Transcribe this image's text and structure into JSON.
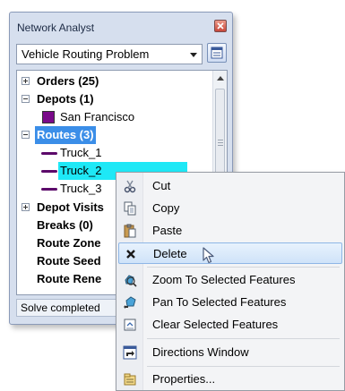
{
  "window": {
    "title": "Network Analyst",
    "combo_value": "Vehicle Routing Problem",
    "status": "Solve completed"
  },
  "tree": {
    "orders": "Orders (25)",
    "depots": "Depots (1)",
    "depot_item": "San Francisco",
    "routes": "Routes (3)",
    "route_items": [
      "Truck_1",
      "Truck_2",
      "Truck_3"
    ],
    "depot_visits": "Depot Visits",
    "breaks": "Breaks (0)",
    "route_zones": "Route Zone",
    "route_seeds": "Route Seed",
    "route_renewals": "Route Rene"
  },
  "menu": {
    "cut": "Cut",
    "copy": "Copy",
    "paste": "Paste",
    "delete": "Delete",
    "zoom": "Zoom To Selected Features",
    "pan": "Pan To Selected Features",
    "clear": "Clear Selected Features",
    "directions": "Directions Window",
    "properties": "Properties..."
  },
  "colors": {
    "selection_blue": "#3b8ee8",
    "selection_cyan": "#1ee8f6",
    "route_purple": "#5c0a6a",
    "depot_purple": "#7a0a8a"
  }
}
